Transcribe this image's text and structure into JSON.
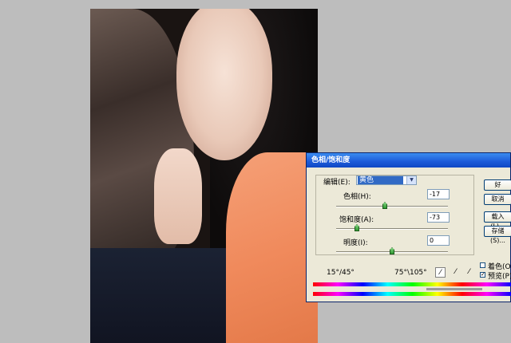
{
  "dialog": {
    "title": "色相/饱和度",
    "edit_label": "编辑(E):",
    "edit_value": "黄色",
    "hue_label": "色相(H):",
    "hue_value": "-17",
    "saturation_label": "饱和度(A):",
    "saturation_value": "-73",
    "lightness_label": "明度(I):",
    "lightness_value": "0",
    "range_left": "15°/45°",
    "range_right": "75°\\105°",
    "buttons": {
      "ok": "好",
      "cancel": "取消",
      "load": "载入(L)...",
      "save": "存储(S)..."
    },
    "colorize_label": "着色(O)",
    "preview_label": "预览(P)",
    "colorize_checked": false,
    "preview_checked": true,
    "icons": [
      "eyedropper-icon",
      "eyedropper-plus-icon",
      "eyedropper-minus-icon"
    ]
  },
  "colors": {
    "titlebar": "#1c5ad8",
    "dialog_bg": "#ece9d8",
    "canvas_bg": "#bdbdbd",
    "selection": "#316ac5"
  }
}
